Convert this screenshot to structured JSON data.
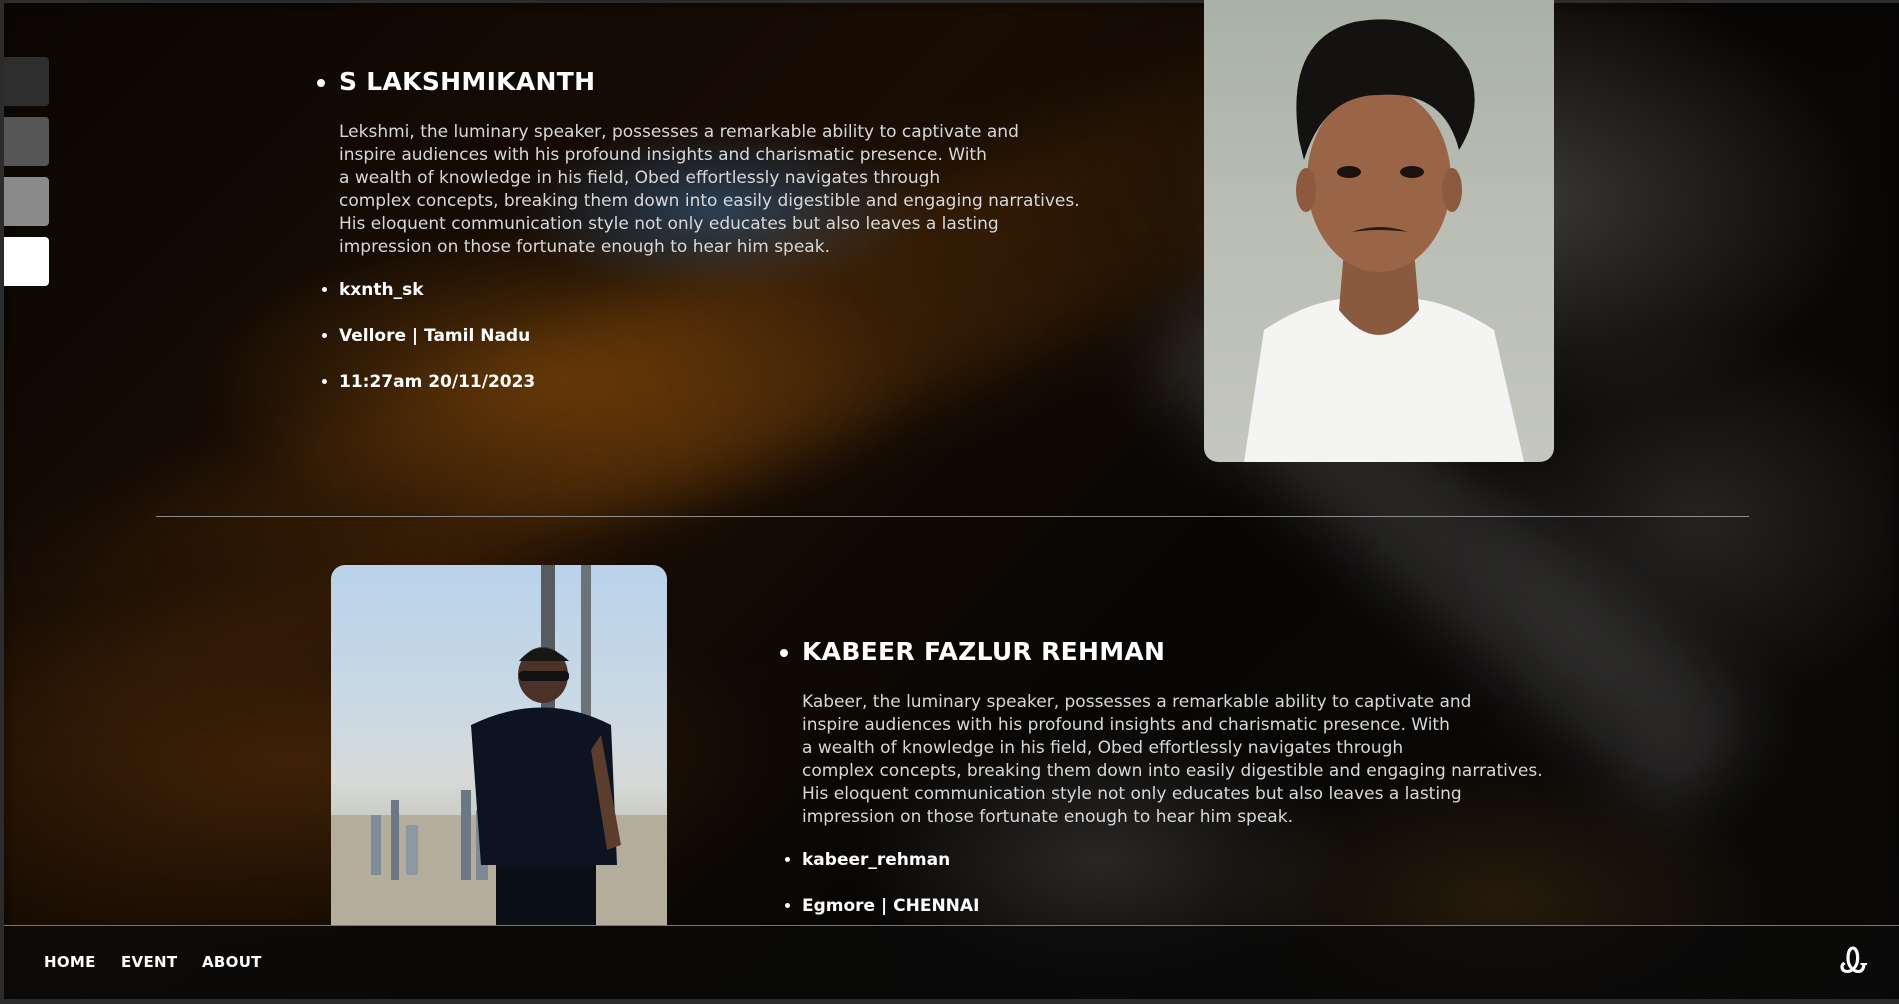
{
  "speakers": [
    {
      "name": "S LAKSHMIKANTH",
      "bio": "Lekshmi, the luminary speaker, possesses a remarkable ability to captivate and\ninspire audiences with his profound insights and charismatic presence. With\na wealth of knowledge in his field, Obed effortlessly navigates through\ncomplex concepts, breaking them down into easily digestible and engaging narratives.\nHis eloquent communication style not only educates but also leaves a lasting\nimpression on those fortunate enough to hear him speak.",
      "handle": "kxnth_sk",
      "location": "Vellore | Tamil Nadu",
      "time": "11:27am 20/11/2023"
    },
    {
      "name": "KABEER FAZLUR REHMAN",
      "bio": "Kabeer, the luminary speaker, possesses a remarkable ability to captivate and\ninspire audiences with his profound insights and charismatic presence. With\na wealth of knowledge in his field, Obed effortlessly navigates through\ncomplex concepts, breaking them down into easily digestible and engaging narratives.\nHis eloquent communication style not only educates but also leaves a lasting\nimpression on those fortunate enough to hear him speak.",
      "handle": "kabeer_rehman",
      "location": "Egmore | CHENNAI"
    }
  ],
  "nav": {
    "items": [
      "HOME",
      "EVENT",
      "ABOUT"
    ],
    "logo": "Ꮂ"
  },
  "theme_swatches": [
    "#2e2e2e",
    "#555555",
    "#8a8a8a",
    "#ffffff"
  ]
}
